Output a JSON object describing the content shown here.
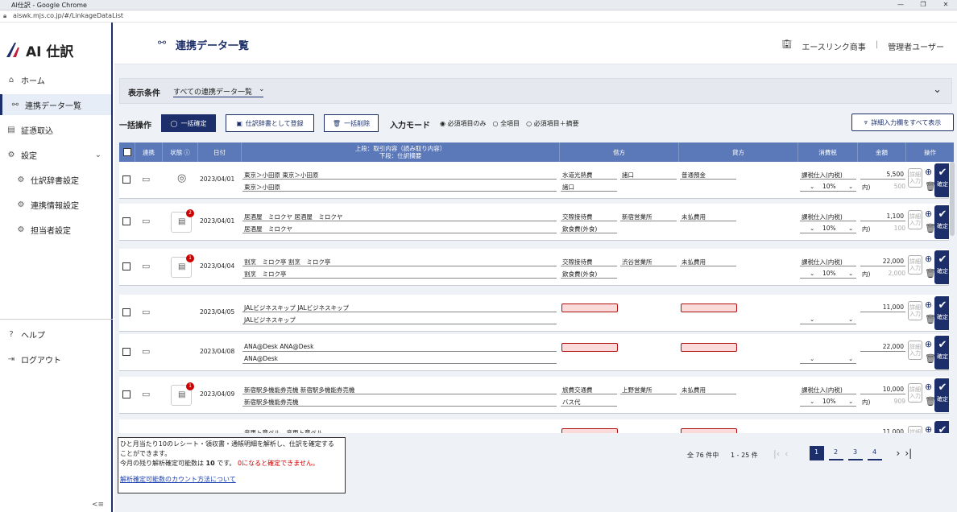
{
  "browser": {
    "title": "AI仕訳 - Google Chrome",
    "url": "aiswk.mjs.co.jp/#/LinkageDataList"
  },
  "brand": {
    "logo": "AI 仕訳"
  },
  "sidebar": {
    "items": [
      {
        "label": "ホーム",
        "icon": "home-icon"
      },
      {
        "label": "連携データ一覧",
        "icon": "link-icon"
      },
      {
        "label": "証憑取込",
        "icon": "import-icon"
      },
      {
        "label": "設定",
        "icon": "gear-icon"
      },
      {
        "label": "仕訳辞書設定",
        "icon": "gear-icon"
      },
      {
        "label": "連携情報設定",
        "icon": "gear-icon"
      },
      {
        "label": "担当者設定",
        "icon": "gear-icon"
      },
      {
        "label": "ヘルプ",
        "icon": "help-icon"
      },
      {
        "label": "ログアウト",
        "icon": "logout-icon"
      }
    ],
    "collapse": "<≡"
  },
  "header": {
    "title": "連携データ一覧",
    "company": "エースリンク商事",
    "separator": "|",
    "user": "管理者ユーザー"
  },
  "filter": {
    "label": "表示条件",
    "value": "すべての連携データ一覧"
  },
  "bulk": {
    "label": "一括操作",
    "confirm": "一括確定",
    "register": "仕訳辞書として登録",
    "delete": "一括削除",
    "mode_label": "入力モード",
    "modes": [
      "必須項目のみ",
      "全項目",
      "必須項目＋摘要"
    ],
    "show_all": "詳細入力欄をすべて表示"
  },
  "table": {
    "headers": {
      "link": "連携",
      "status": "状態",
      "date": "日付",
      "desc_top": "上段：取引内容（読み取り内容）",
      "desc_bottom": "下段：仕訳摘要",
      "debit": "借方",
      "credit": "貸方",
      "tax": "消費税",
      "amount": "金額",
      "ops": "操作"
    },
    "rows": [
      {
        "date": "2023/04/01",
        "desc1": "東京＞小田原 東京＞小田原",
        "desc2": "東京＞小田原",
        "debit": "水道光熱費",
        "debit_sub": "諸口",
        "debit2": "諸口",
        "credit": "普通預金",
        "tax": "課税仕入(内税)",
        "rate": "10%",
        "amount": "5,500",
        "tax_amt": "500",
        "badge": "",
        "status": "ai"
      },
      {
        "date": "2023/04/01",
        "desc1": "居酒屋　ミロクヤ 居酒屋　ミロクヤ",
        "desc2": "居酒屋　ミロクヤ",
        "debit": "交際接待費",
        "debit_sub": "新宿営業所",
        "debit2": "飲食費(外食)",
        "credit": "未払費用",
        "tax": "課税仕入(内税)",
        "rate": "10%",
        "amount": "1,100",
        "tax_amt": "100",
        "badge": "2",
        "status": "receipt"
      },
      {
        "date": "2023/04/04",
        "desc1": "割烹　ミロク亭 割烹　ミロク亭",
        "desc2": "割烹　ミロク亭",
        "debit": "交際接待費",
        "debit_sub": "渋谷営業所",
        "debit2": "飲食費(外食)",
        "credit": "未払費用",
        "tax": "課税仕入(内税)",
        "rate": "10%",
        "amount": "22,000",
        "tax_amt": "2,000",
        "badge": "1",
        "status": "receipt"
      },
      {
        "date": "2023/04/05",
        "desc1": "JALビジネスキップ JALビジネスキップ",
        "desc2": "JALビジネスキップ",
        "debit": "",
        "debit_sub": "",
        "debit2": "",
        "credit": "",
        "tax": "",
        "rate": "",
        "amount": "11,000",
        "tax_amt": "",
        "badge": "",
        "status": "none"
      },
      {
        "date": "2023/04/08",
        "desc1": "ANA@Desk ANA@Desk",
        "desc2": "ANA@Desk",
        "debit": "",
        "debit_sub": "",
        "debit2": "",
        "credit": "",
        "tax": "",
        "rate": "",
        "amount": "22,000",
        "tax_amt": "",
        "badge": "",
        "status": "none"
      },
      {
        "date": "2023/04/09",
        "desc1": "新宿駅多機能券売機 新宿駅多機能券売機",
        "desc2": "新宿駅多機能券売機",
        "debit": "旅費交通費",
        "debit_sub": "上野営業所",
        "debit2": "バス代",
        "credit": "未払費用",
        "tax": "課税仕入(内税)",
        "rate": "10%",
        "amount": "10,000",
        "tax_amt": "909",
        "badge": "1",
        "status": "receipt"
      },
      {
        "date": "",
        "desc1": "音更ト章ペル　音更ト章ペル",
        "desc2": "",
        "debit": "",
        "debit_sub": "",
        "debit2": "",
        "credit": "",
        "tax": "",
        "rate": "",
        "amount": "11,000",
        "tax_amt": "",
        "badge": "",
        "status": "none"
      }
    ],
    "detail_label": "詳細入力",
    "confirm_label": "確定",
    "tax_prefix": "内)"
  },
  "info": {
    "line1": "ひと月当たり10のレシート・領収書・通帳明細を解析し、仕訳を確定する",
    "line1b": "ことができます。",
    "line2a": "今月の残り解析確定可能数は",
    "line2b": "10",
    "line2c": "です。",
    "line2d": "0になると確定できません。",
    "link": "解析確定可能数のカウント方法について"
  },
  "pagination": {
    "total": "全 76 件中",
    "range": "1 - 25 件",
    "pages": [
      "1",
      "2",
      "3",
      "4"
    ]
  },
  "colors": {
    "navy": "#1d2f6a",
    "header": "#5b78b8",
    "error": "#b01010"
  }
}
